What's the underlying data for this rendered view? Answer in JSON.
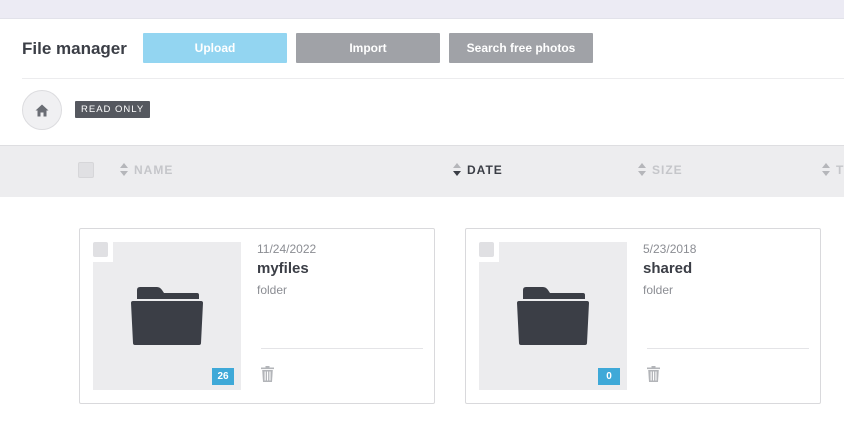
{
  "header": {
    "title": "File manager",
    "buttons": {
      "upload": "Upload",
      "import": "Import",
      "search_photos": "Search free photos"
    }
  },
  "breadcrumb": {
    "home_icon": "home-icon",
    "badge": "READ ONLY"
  },
  "columns": {
    "name": "NAME",
    "date": "DATE",
    "size": "SIZE",
    "type": "T"
  },
  "items": [
    {
      "date": "11/24/2022",
      "name": "myfiles",
      "type": "folder",
      "count": "26",
      "icon": "folder-icon"
    },
    {
      "date": "5/23/2018",
      "name": "shared",
      "type": "folder",
      "count": "0",
      "icon": "folder-icon"
    }
  ],
  "colors": {
    "upload": "#93d5f1",
    "secondary_button": "#a0a2a7",
    "badge": "#3fa9d8",
    "folder": "#3b3e46"
  }
}
